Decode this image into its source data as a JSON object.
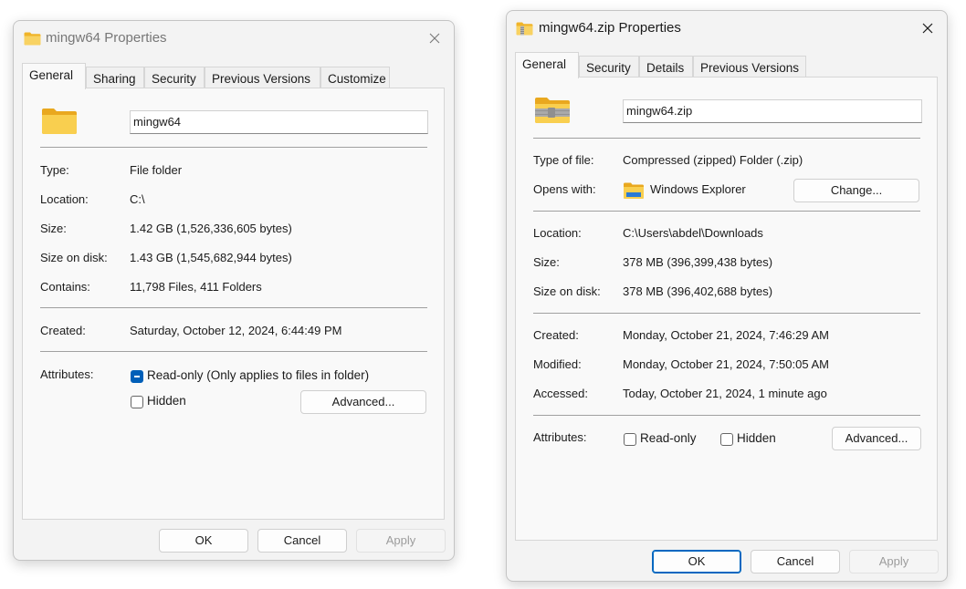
{
  "dialogs": {
    "folder": {
      "title": "mingw64 Properties",
      "tabs": [
        "General",
        "Sharing",
        "Security",
        "Previous Versions",
        "Customize"
      ],
      "name_value": "mingw64",
      "rows": {
        "type": {
          "label": "Type:",
          "value": "File folder"
        },
        "location": {
          "label": "Location:",
          "value": "C:\\"
        },
        "size": {
          "label": "Size:",
          "value": "1.42 GB (1,526,336,605 bytes)"
        },
        "size_on_disk": {
          "label": "Size on disk:",
          "value": "1.43 GB (1,545,682,944 bytes)"
        },
        "contains": {
          "label": "Contains:",
          "value": "11,798 Files, 411 Folders"
        },
        "created": {
          "label": "Created:",
          "value": "Saturday, October 12, 2024, 6:44:49 PM"
        }
      },
      "attributes_label": "Attributes:",
      "readonly_label": "Read-only (Only applies to files in folder)",
      "readonly_state": "indeterminate",
      "hidden_label": "Hidden",
      "hidden_state": "unchecked",
      "advanced_label": "Advanced...",
      "ok_label": "OK",
      "cancel_label": "Cancel",
      "apply_label": "Apply"
    },
    "zip": {
      "title": "mingw64.zip Properties",
      "tabs": [
        "General",
        "Security",
        "Details",
        "Previous Versions"
      ],
      "name_value": "mingw64.zip",
      "rows": {
        "type": {
          "label": "Type of file:",
          "value": "Compressed (zipped) Folder (.zip)"
        },
        "opens_with": {
          "label": "Opens with:",
          "value": "Windows Explorer"
        },
        "location": {
          "label": "Location:",
          "value": "C:\\Users\\abdel\\Downloads"
        },
        "size": {
          "label": "Size:",
          "value": "378 MB (396,399,438 bytes)"
        },
        "size_on_disk": {
          "label": "Size on disk:",
          "value": "378 MB (396,402,688 bytes)"
        },
        "created": {
          "label": "Created:",
          "value": "Monday, October 21, 2024, 7:46:29 AM"
        },
        "modified": {
          "label": "Modified:",
          "value": "Monday, October 21, 2024, 7:50:05 AM"
        },
        "accessed": {
          "label": "Accessed:",
          "value": "Today, October 21, 2024, 1 minute ago"
        }
      },
      "change_label": "Change...",
      "attributes_label": "Attributes:",
      "readonly_label": "Read-only",
      "readonly_state": "unchecked",
      "hidden_label": "Hidden",
      "hidden_state": "unchecked",
      "advanced_label": "Advanced...",
      "ok_label": "OK",
      "cancel_label": "Cancel",
      "apply_label": "Apply"
    }
  },
  "icons": {
    "folder": "folder-icon",
    "zip": "zip-folder-icon",
    "explorer": "file-explorer-icon",
    "close": "close-icon"
  },
  "colors": {
    "accent": "#005fb8",
    "folder_yellow": "#f8c94a",
    "dialog_bg": "#f3f3f3"
  }
}
